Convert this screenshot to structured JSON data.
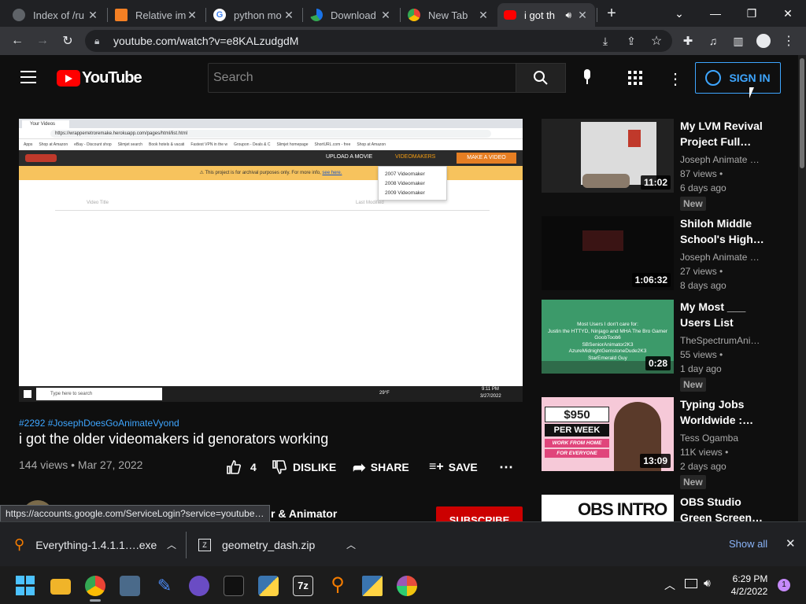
{
  "browser": {
    "tabs": [
      {
        "label": "Index of /ru",
        "icon": "globe-icon"
      },
      {
        "label": "Relative im",
        "icon": "stackoverflow-icon"
      },
      {
        "label": "python mo",
        "icon": "google-icon"
      },
      {
        "label": "Download",
        "icon": "download-site-icon"
      },
      {
        "label": "New Tab",
        "icon": "chrome-icon"
      },
      {
        "label": "i got th",
        "icon": "youtube-icon"
      }
    ],
    "new_tab": "+",
    "url": "youtube.com/watch?v=e8KALzudgdM"
  },
  "youtube": {
    "logo_text": "YouTube",
    "search_placeholder": "Search",
    "sign_in": "SIGN IN",
    "video": {
      "hashtags": "#2292 #JosephDoesGoAnimateVyond",
      "title": "i got the older videomakers id genorators working",
      "views_date": "144 views • Mar 27, 2022",
      "likes": "4",
      "dislike": "DISLIKE",
      "share": "SHARE",
      "save": "SAVE",
      "channel_partial": "r & Animator",
      "subscribe": "SUBSCRIBE"
    },
    "embedded": {
      "tab_label": "Your Videos",
      "url": "https://wrapperretroremake.herokuapp.com/pages/html/list.html",
      "bookmarks": [
        "Apps",
        "Shop at Amazon",
        "eBay - Discount shop",
        "Slimjet search",
        "Book hotels & vacati",
        "Fastest VPN in the w",
        "Groupon - Deals & C",
        "Slimjet homepage",
        "ShortURL.com - free",
        "Shop at Amazon"
      ],
      "nav": [
        "UPLOAD A MOVIE",
        "VIDEOMAKERS",
        "MAKE A VIDEO"
      ],
      "banner": "⚠ This project is for archival purposes only. For more info,",
      "banner_link": "see here.",
      "menu": [
        "2007 Videomaker",
        "2008 Videomaker",
        "2009 Videomaker"
      ],
      "col_title": "Video Title",
      "col_modified": "Last Modified",
      "taskbar_search": "Type here to search",
      "temp": "29°F",
      "time": "9:11 PM",
      "date": "3/27/2022"
    },
    "sidebar": [
      {
        "title": "My LVM Revival Project Full…",
        "channel": "Joseph Animate …",
        "views": "87 views •",
        "age": "6 days ago",
        "duration": "11:02",
        "badge": "New"
      },
      {
        "title": "Shiloh Middle School's High…",
        "channel": "Joseph Animate …",
        "views": "27 views •",
        "age": "8 days ago",
        "duration": "1:06:32"
      },
      {
        "title": "My Most ___ Users List",
        "channel": "TheSpectrumAni…",
        "views": "55 views •",
        "age": "1 day ago",
        "duration": "0:28",
        "badge": "New",
        "thumb_text": [
          "Most Users I don't care for:",
          "Justin the HTTYD, Ninjago and MHA The Bro Gamer",
          "GoobToob6",
          "SBSeniorAnimator2K3",
          "AzureMidnightGemstoneDude2K3",
          "StarEmerald Guy"
        ]
      },
      {
        "title": "Typing Jobs Worldwide :…",
        "channel": "Tess Ogamba",
        "views": "11K views •",
        "age": "2 days ago",
        "duration": "13:09",
        "badge": "New",
        "thumb_text": [
          "$950",
          "PER WEEK",
          "WORK FROM HOME",
          "FOR EVERYONE"
        ]
      },
      {
        "title": "OBS Studio Green Screen…",
        "thumb_text": [
          "OBS INTRO"
        ]
      }
    ]
  },
  "status_url": "https://accounts.google.com/ServiceLogin?service=youtube…",
  "downloads": {
    "items": [
      "Everything-1.4.1.1….exe",
      "geometry_dash.zip"
    ],
    "show_all": "Show all"
  },
  "taskbar": {
    "time": "6:29 PM",
    "date": "4/2/2022",
    "notif": "1"
  },
  "colors": {
    "yt_red": "#ff0000",
    "link_blue": "#3ea6ff",
    "hashtag_blue": "#3ea6ff"
  }
}
